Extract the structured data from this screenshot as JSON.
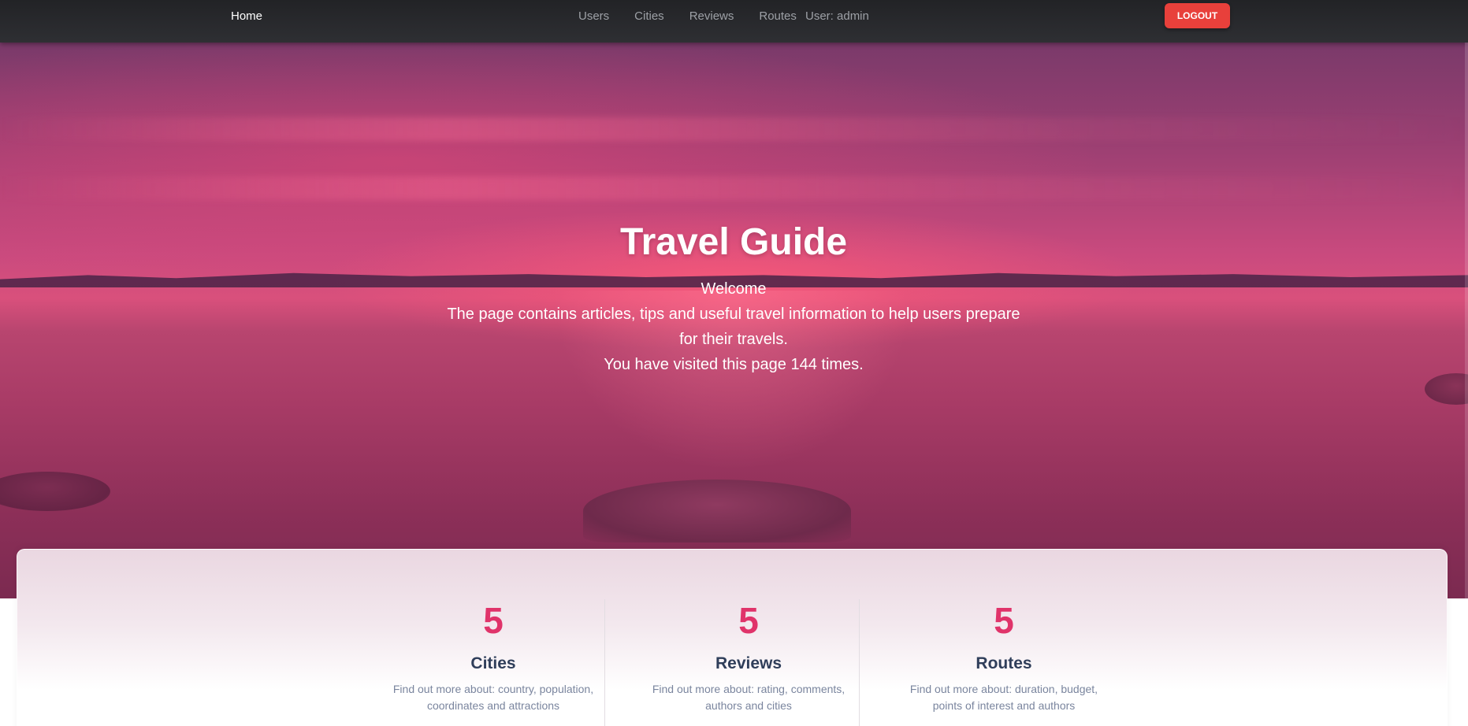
{
  "nav": {
    "brand": "Home",
    "links": [
      "Users",
      "Cities",
      "Reviews",
      "Routes"
    ],
    "user": "User: admin",
    "logout": "LOGOUT"
  },
  "hero": {
    "title": "Travel Guide",
    "welcome": "Welcome",
    "description": "The page contains articles, tips and useful travel information to help users prepare for their travels.",
    "visits": "You have visited this page 144 times."
  },
  "stats": [
    {
      "number": "5",
      "title": "Cities",
      "description": "Find out more about: country, population, coordinates and attractions"
    },
    {
      "number": "5",
      "title": "Reviews",
      "description": "Find out more about: rating, comments, authors and cities"
    },
    {
      "number": "5",
      "title": "Routes",
      "description": "Find out more about: duration, budget, points of interest and authors"
    }
  ],
  "colors": {
    "navbar": "#2a2b2f",
    "logout": "#e8403b",
    "accent": "#e0336a",
    "heading": "#2f3e5a",
    "muted": "#7a859e"
  }
}
